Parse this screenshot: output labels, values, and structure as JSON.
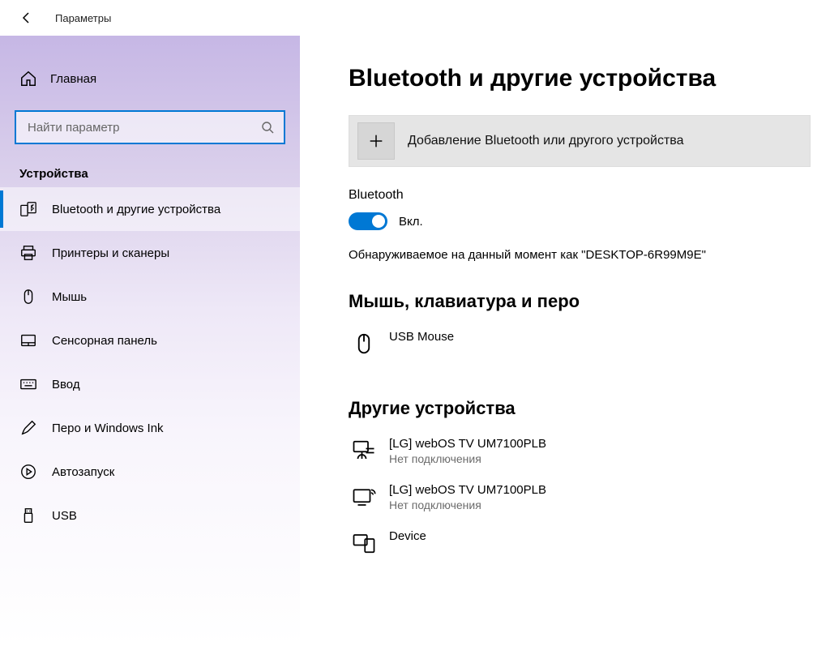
{
  "window": {
    "title": "Параметры"
  },
  "sidebar": {
    "home": "Главная",
    "search_placeholder": "Найти параметр",
    "category": "Устройства",
    "items": [
      {
        "label": "Bluetooth и другие устройства"
      },
      {
        "label": "Принтеры и сканеры"
      },
      {
        "label": "Мышь"
      },
      {
        "label": "Сенсорная панель"
      },
      {
        "label": "Ввод"
      },
      {
        "label": "Перо и Windows Ink"
      },
      {
        "label": "Автозапуск"
      },
      {
        "label": "USB"
      }
    ]
  },
  "main": {
    "heading": "Bluetooth и другие устройства",
    "add_label": "Добавление Bluetooth или другого устройства",
    "bt_label": "Bluetooth",
    "bt_state": "Вкл.",
    "discoverable": "Обнаруживаемое на данный момент как \"DESKTOP-6R99M9E\"",
    "section_mouse": "Мышь, клавиатура и перо",
    "devices_mouse": [
      {
        "name": "USB Mouse"
      }
    ],
    "section_other": "Другие устройства",
    "devices_other": [
      {
        "name": "[LG] webOS TV UM7100PLB",
        "status": "Нет подключения"
      },
      {
        "name": "[LG] webOS TV UM7100PLB",
        "status": "Нет подключения"
      },
      {
        "name": "Device"
      }
    ]
  }
}
